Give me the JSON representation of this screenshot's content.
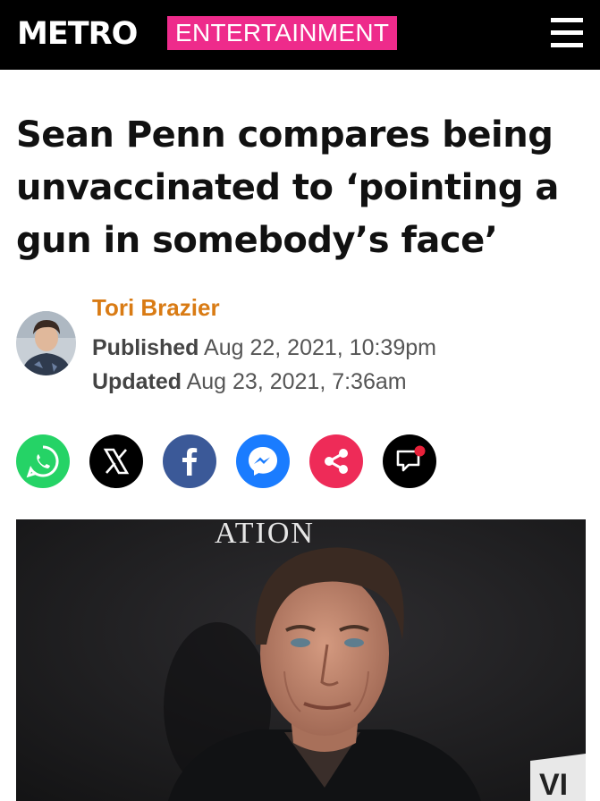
{
  "header": {
    "logo": "METRO",
    "section": "ENTERTAINMENT",
    "colors": {
      "bar": "#000000",
      "section_badge": "#ee2b8b"
    },
    "menu_icon": "hamburger-menu-icon"
  },
  "article": {
    "headline": "Sean Penn compares being unvaccinated to ‘pointing a gun in somebody’s face’",
    "author": {
      "name": "Tori Brazier",
      "color": "#d97b14"
    },
    "published_label": "Published",
    "published_value": "Aug 22, 2021, 10:39pm",
    "updated_label": "Updated",
    "updated_value": "Aug 23, 2021, 7:36am"
  },
  "share_buttons": [
    {
      "icon": "whatsapp-icon",
      "color": "#25d366"
    },
    {
      "icon": "x-icon",
      "color": "#000000"
    },
    {
      "icon": "facebook-icon",
      "color": "#3b5998"
    },
    {
      "icon": "messenger-icon",
      "color": "#1a7cff"
    },
    {
      "icon": "share-icon",
      "color": "#ee2b58"
    },
    {
      "icon": "comments-icon",
      "color": "#000000"
    }
  ],
  "hero_image": {
    "backdrop_text": "ATION",
    "corner_text": "VI"
  }
}
